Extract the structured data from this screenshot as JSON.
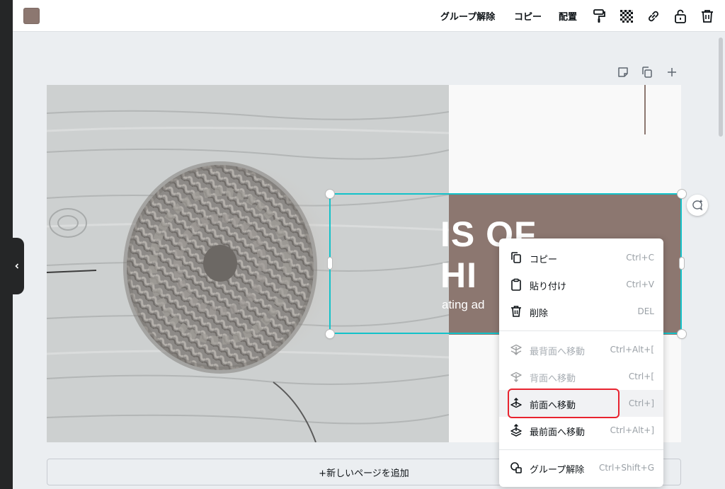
{
  "toolbar": {
    "color_swatch": "#8c7770",
    "ungroup_label": "グループ解除",
    "copy_label": "コピー",
    "arrange_label": "配置",
    "icons": [
      "paint-roller-icon",
      "transparency-icon",
      "link-icon",
      "lock-icon",
      "trash-icon"
    ]
  },
  "canvas": {
    "actions": [
      "note-icon",
      "duplicate-icon",
      "add-icon"
    ],
    "text_line1": "IS OF",
    "text_line2": "HI",
    "text_sub": "ating ad",
    "brand_color": "#8c7770",
    "selection_color": "#13c2c9"
  },
  "context_menu": {
    "items": [
      {
        "label": "コピー",
        "shortcut": "Ctrl+C",
        "icon": "copy-icon",
        "enabled": true
      },
      {
        "label": "貼り付け",
        "shortcut": "Ctrl+V",
        "icon": "clipboard-icon",
        "enabled": true
      },
      {
        "label": "削除",
        "shortcut": "DEL",
        "icon": "trash-icon",
        "enabled": true
      },
      {
        "label": "最背面へ移動",
        "shortcut": "Ctrl+Alt+[",
        "icon": "send-to-back-icon",
        "enabled": false
      },
      {
        "label": "背面へ移動",
        "shortcut": "Ctrl+[",
        "icon": "send-backward-icon",
        "enabled": false
      },
      {
        "label": "前面へ移動",
        "shortcut": "Ctrl+]",
        "icon": "bring-forward-icon",
        "enabled": true
      },
      {
        "label": "最前面へ移動",
        "shortcut": "Ctrl+Alt+]",
        "icon": "bring-to-front-icon",
        "enabled": true
      },
      {
        "label": "グループ解除",
        "shortcut": "Ctrl+Shift+G",
        "icon": "ungroup-icon",
        "enabled": true
      }
    ],
    "highlight_color": "#e8232f"
  },
  "footer": {
    "add_page_label": "+新しいページを追加"
  }
}
